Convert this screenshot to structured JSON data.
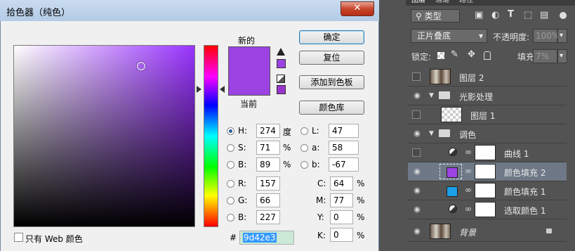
{
  "picker": {
    "title": "拾色器（纯色）",
    "close": "✕",
    "new_label": "新的",
    "current_label": "当前",
    "new_color": "#9d42e3",
    "current_color": "#9d42e3",
    "buttons": {
      "ok": "确定",
      "reset": "复位",
      "add_swatch": "添加到色板",
      "libraries": "颜色库"
    },
    "fields": {
      "H": {
        "label": "H:",
        "value": "274",
        "unit": "度"
      },
      "S": {
        "label": "S:",
        "value": "71",
        "unit": "%"
      },
      "Bv": {
        "label": "B:",
        "value": "89",
        "unit": "%"
      },
      "R": {
        "label": "R:",
        "value": "157"
      },
      "G": {
        "label": "G:",
        "value": "66"
      },
      "B": {
        "label": "B:",
        "value": "227"
      },
      "L": {
        "label": "L:",
        "value": "47"
      },
      "a": {
        "label": "a:",
        "value": "58"
      },
      "b": {
        "label": "b:",
        "value": "-67"
      },
      "C": {
        "label": "C:",
        "value": "64",
        "unit": "%"
      },
      "M": {
        "label": "M:",
        "value": "77",
        "unit": "%"
      },
      "Y": {
        "label": "Y:",
        "value": "0",
        "unit": "%"
      },
      "K": {
        "label": "K:",
        "value": "0",
        "unit": "%"
      }
    },
    "hex_label": "#",
    "hex": "9d42e3",
    "web_only": "只有 Web 颜色"
  },
  "layers": {
    "tabs": [
      "图层",
      "通道",
      "路径"
    ],
    "filter_kind": "类型",
    "blend_mode": "正片叠底",
    "opacity_label": "不透明度:",
    "opacity": "100%",
    "lock_label": "锁定:",
    "fill_label": "填充:",
    "fill": "7%",
    "items": [
      {
        "name": "图层 2",
        "visible": false
      },
      {
        "name": "光影处理",
        "visible": true,
        "group": true
      },
      {
        "name": "图层 1",
        "visible": false
      },
      {
        "name": "调色",
        "visible": true,
        "group": true
      },
      {
        "name": "曲线 1",
        "visible": false
      },
      {
        "name": "颜色填充 2",
        "visible": true,
        "selected": true,
        "fill_color": "#9d42e3"
      },
      {
        "name": "颜色填充 1",
        "visible": true,
        "fill_color": "#1aa0e8"
      },
      {
        "name": "选取颜色 1",
        "visible": true
      },
      {
        "name": "背景",
        "visible": true
      }
    ]
  }
}
